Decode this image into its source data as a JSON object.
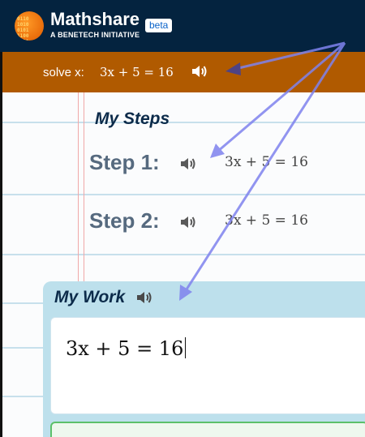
{
  "header": {
    "brand": "Mathshare",
    "tagline": "A BENETECH INITIATIVE",
    "badge": "beta",
    "logo_bits": "0110 1010 0101 1100 0011"
  },
  "problem": {
    "label": "solve x:",
    "equation": "3x + 5 = 16",
    "speaker_icon": "speaker-icon"
  },
  "steps_section": {
    "title": "My Steps",
    "steps": [
      {
        "label": "Step 1:",
        "equation": "3x + 5 = 16"
      },
      {
        "label": "Step 2:",
        "equation": "3x + 5 = 16"
      }
    ]
  },
  "work": {
    "title": "My Work",
    "editor_value": "3x + 5 = 16"
  },
  "colors": {
    "header_bg": "#04233f",
    "problem_bg": "#b05a00",
    "work_bg": "#bde0ec",
    "annotation_arrow": "#7f83ee"
  }
}
